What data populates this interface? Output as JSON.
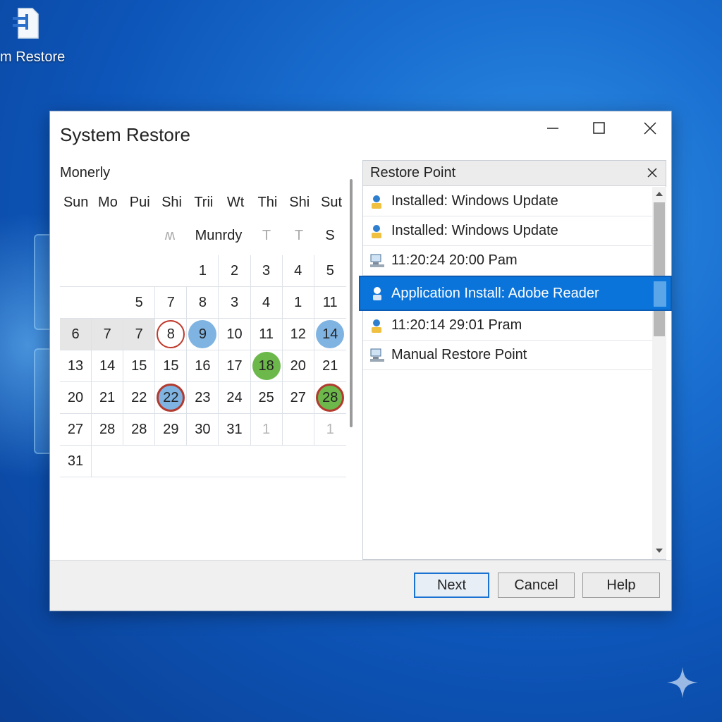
{
  "desktop": {
    "icon_label": "m Restore"
  },
  "window": {
    "title": "System Restore",
    "controls": {
      "minimize": "minimize-icon",
      "maximize": "maximize-icon",
      "close": "close-icon"
    }
  },
  "calendar": {
    "month_label": "Monerly",
    "weekdays": [
      "Sun",
      "Mo",
      "Pui",
      "Shi",
      "Trii",
      "Wt",
      "Thi",
      "Shi",
      "Sut"
    ],
    "subheader": [
      "ʍ",
      "Munrdy",
      "T",
      "T",
      "S"
    ],
    "rows": [
      [
        "",
        "",
        "",
        "",
        "1",
        "2",
        "3",
        "4",
        "5"
      ],
      [
        "",
        "",
        "5",
        "7",
        "8",
        "3",
        "4",
        "1",
        "11"
      ],
      [
        "6",
        "7",
        "7",
        "8",
        "9",
        "10",
        "11",
        "12",
        "14"
      ],
      [
        "13",
        "14",
        "15",
        "15",
        "16",
        "17",
        "18",
        "20",
        "21"
      ],
      [
        "20",
        "21",
        "22",
        "22",
        "23",
        "24",
        "25",
        "27",
        "28"
      ],
      [
        "27",
        "28",
        "28",
        "29",
        "30",
        "31",
        "1",
        "",
        "1"
      ],
      [
        "31",
        "",
        "",
        "",
        "",
        "",
        "",
        "",
        ""
      ]
    ]
  },
  "restore_panel": {
    "header": "Restore Point",
    "items": [
      {
        "label": "Installed: Windows Update",
        "icon": "user-update-icon"
      },
      {
        "label": "Installed: Windows Update",
        "icon": "user-update-icon"
      },
      {
        "label": "11:20:24 20:00 Pam",
        "icon": "computer-icon"
      },
      {
        "label": "Application Install: Adobe Reader",
        "icon": "user-install-icon",
        "selected": true
      },
      {
        "label": "11:20:14 29:01 Pram",
        "icon": "user-update-icon"
      },
      {
        "label": "Manual Restore Point",
        "icon": "computer-icon"
      }
    ]
  },
  "footer": {
    "next": "Next",
    "cancel": "Cancel",
    "help": "Help"
  },
  "colors": {
    "accent": "#0a74da",
    "marker_blue": "#7fb3e2",
    "marker_green": "#6cb84a",
    "marker_ring": "#c0392b"
  }
}
